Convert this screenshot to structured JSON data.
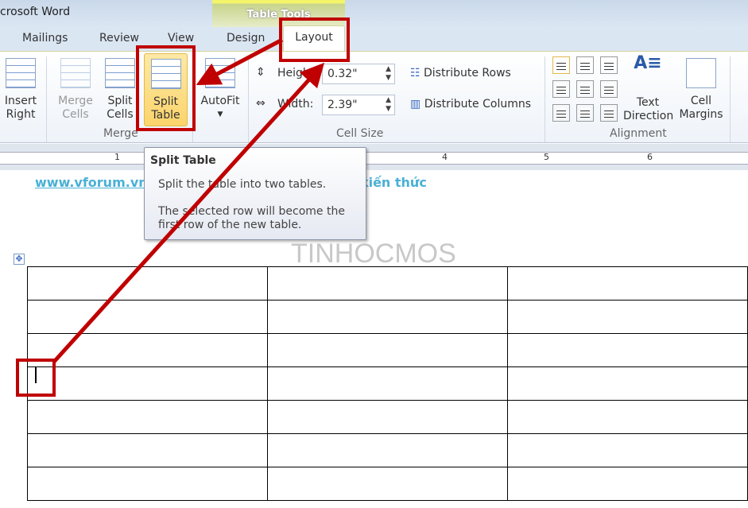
{
  "window": {
    "title": "crosoft Word",
    "context_tab": "Table Tools"
  },
  "tabs": [
    {
      "label": "Mailings"
    },
    {
      "label": "Review"
    },
    {
      "label": "View"
    },
    {
      "label": "Design"
    },
    {
      "label": "Layout",
      "active": true
    }
  ],
  "ribbon": {
    "insert_right": [
      "Insert",
      "Right"
    ],
    "merge_cells": [
      "Merge",
      "Cells"
    ],
    "split_cells": [
      "Split",
      "Cells"
    ],
    "split_table": [
      "Split",
      "Table"
    ],
    "autofit": "AutoFit",
    "merge_group": "Merge",
    "height_label": "Height:",
    "height_value": "0.32\"",
    "width_label": "Width:",
    "width_value": "2.39\"",
    "distribute_rows": "Distribute Rows",
    "distribute_columns": "Distribute Columns",
    "cell_size_group": "Cell Size",
    "text_direction": [
      "Text",
      "Direction"
    ],
    "cell_margins": [
      "Cell",
      "Margins"
    ],
    "alignment_group": "Alignment"
  },
  "ruler": {
    "numbers": [
      "1",
      "4",
      "5",
      "6"
    ]
  },
  "document": {
    "link": "www.vforum.vn",
    "link_tail": "a sẻ kiến thức",
    "watermark": "TINHOCMOS",
    "table": {
      "rows": 7,
      "cols": 3
    }
  },
  "tooltip": {
    "title": "Split Table",
    "line1": "Split the table into two tables.",
    "line2": "The selected row will become the first row of the new table."
  },
  "colors": {
    "annotation": "#c00000",
    "link": "#4ab0d6",
    "highlight": "#fbd46b"
  }
}
